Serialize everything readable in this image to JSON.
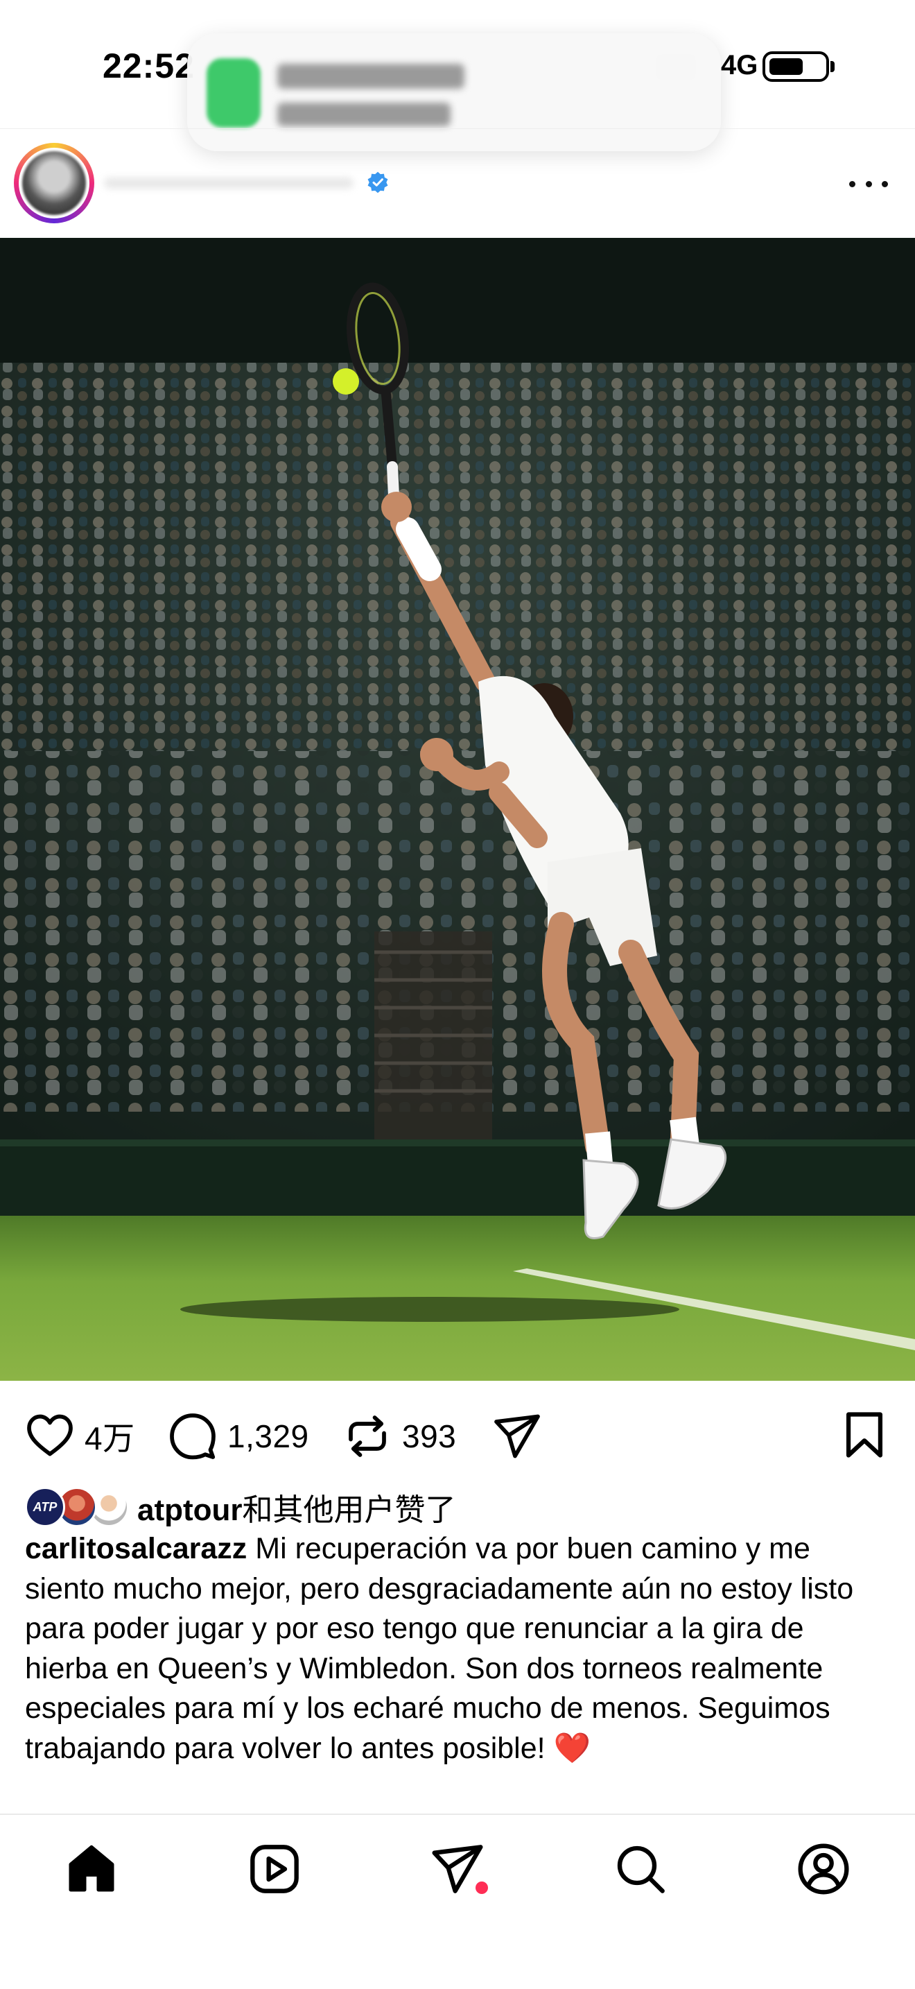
{
  "status_bar": {
    "time": "22:52",
    "network": "4G"
  },
  "post": {
    "image_description": "Tennis player serving at Wimbledon",
    "stats": {
      "likes": "4万",
      "comments": "1,329",
      "reposts": "393"
    },
    "liked_by": {
      "user": "atptour",
      "suffix": "和其他用户赞了",
      "avatar_badge": "ATP"
    },
    "caption": {
      "username": "carlitosalcarazz",
      "text": "Mi recuperación va por buen camino y me siento mucho mejor, pero desgraciadamente aún no estoy listo para poder jugar y por eso tengo que renunciar a la gira de hierba en Queen’s y Wimbledon. Son dos torneos realmente especiales para mí y los echaré mucho de menos. Seguimos trabajando para volver lo antes posible! ❤️"
    }
  },
  "icons": {
    "like": "heart-icon",
    "comment": "comment-icon",
    "repost": "repost-icon",
    "share": "send-icon",
    "save": "bookmark-icon",
    "more": "more-icon",
    "verified": "verified-badge-icon"
  },
  "bottom_nav": [
    {
      "name": "home",
      "icon": "home-icon",
      "active": true
    },
    {
      "name": "reels",
      "icon": "reels-icon",
      "active": false
    },
    {
      "name": "messages",
      "icon": "send-icon",
      "active": false
    },
    {
      "name": "search",
      "icon": "search-icon",
      "active": false
    },
    {
      "name": "profile",
      "icon": "profile-icon",
      "active": false
    }
  ],
  "colors": {
    "verified": "#3897f0",
    "notification_dot": "#ff2d55",
    "grass": "#6f9a36"
  }
}
